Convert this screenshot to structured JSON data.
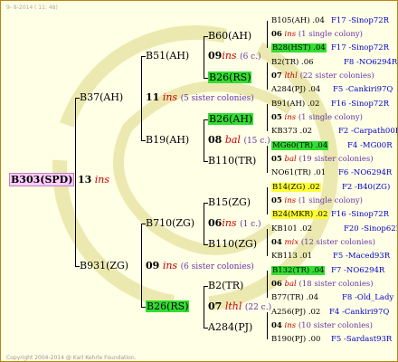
{
  "header": {
    "date": "9- 8-2014 ( 11: 48)"
  },
  "footer": {
    "copyright": "Copyright 2004-2014 @ Karl Kehrle Foundation."
  },
  "root": {
    "name": "B303(SPD)",
    "count": "13",
    "ins": "ins"
  },
  "l1a": {
    "name": "B37(AH)",
    "count": "11",
    "ins": "ins",
    "sis": "(5 sister colonies)"
  },
  "l1b": {
    "name": "B931(ZG)",
    "count": "09",
    "ins": "ins",
    "sis": "(6 sister colonies)"
  },
  "l2a": {
    "name": "B51(AH)",
    "count": "09",
    "ins": "ins",
    "sis": "(6 c.)"
  },
  "l2b": {
    "name": "B19(AH)",
    "count": "08",
    "ins": "bal",
    "sis": "(15 c.)"
  },
  "l2c": {
    "name": "B710(ZG)",
    "count": "06",
    "ins": "ins",
    "sis": "(1 c.)"
  },
  "l2d": {
    "name": "B26(RS)",
    "count": "07",
    "ins": "lthl",
    "sis": "(22 c.)"
  },
  "l3": {
    "a": "B60(AH)",
    "b": "B26(RS)",
    "c": "B26(AH)",
    "d": "B110(TR)",
    "e": "B15(ZG)",
    "f": "B110(ZG)",
    "g": "B2(TR)",
    "h": "A284(PJ)"
  },
  "leaves": [
    {
      "a": "B105(AH) .04",
      "b": "F17 -Sinop72R"
    },
    {
      "n": "06",
      "i": "ins",
      "s": "(1 single colony)"
    },
    {
      "a": "B28(HST) .04",
      "b": "F17 -Sinop72R"
    },
    {
      "a": "B2(TR) .06",
      "b": "F8 -NO6294R"
    },
    {
      "n": "07",
      "i": "lthl",
      "s": "(22 sister colonies)"
    },
    {
      "a": "A284(PJ) .04",
      "b": "F5 -Cankiri97Q"
    },
    {
      "a": "B91(AH) .02",
      "b": "F16 -Sinop72R"
    },
    {
      "n": "05",
      "i": "ins",
      "s": "(1 single colony)"
    },
    {
      "a": "KB373 .02",
      "b": "F2 -Carpath00R"
    },
    {
      "a": "MG60(TR) .04",
      "b": "F4 -MG00R"
    },
    {
      "n": "05",
      "i": "bal",
      "s": "(19 sister colonies)"
    },
    {
      "a": "NO61(TR) .01",
      "b": "F6 -NO6294R"
    },
    {
      "a": "B14(ZG) .02",
      "b": "F2 -B40(ZG)"
    },
    {
      "n": "05",
      "i": "ins",
      "s": "(1 single colony)"
    },
    {
      "a": "B24(MKR) .02",
      "b": "F16 -Sinop72R"
    },
    {
      "a": "KB101 .02",
      "b": "F20 -Sinop62R"
    },
    {
      "n": "04",
      "i": "mix",
      "s": "(12 sister colonies)"
    },
    {
      "a": "KB113 .01",
      "b": "F5 -Maced93R"
    },
    {
      "a": "B132(TR) .04",
      "b": "F7 -NO6294R"
    },
    {
      "n": "06",
      "i": "bal",
      "s": "(18 sister colonies)"
    },
    {
      "a": "B77(TR) .04",
      "b": "F8 -Old_Lady"
    },
    {
      "a": "A256(PJ) .02",
      "b": "F4 -Cankiri97Q"
    },
    {
      "n": "04",
      "i": "ins",
      "s": "(10 sister colonies)"
    },
    {
      "a": "B190(PJ) .00",
      "b": "F5 -Sardast93R"
    }
  ]
}
